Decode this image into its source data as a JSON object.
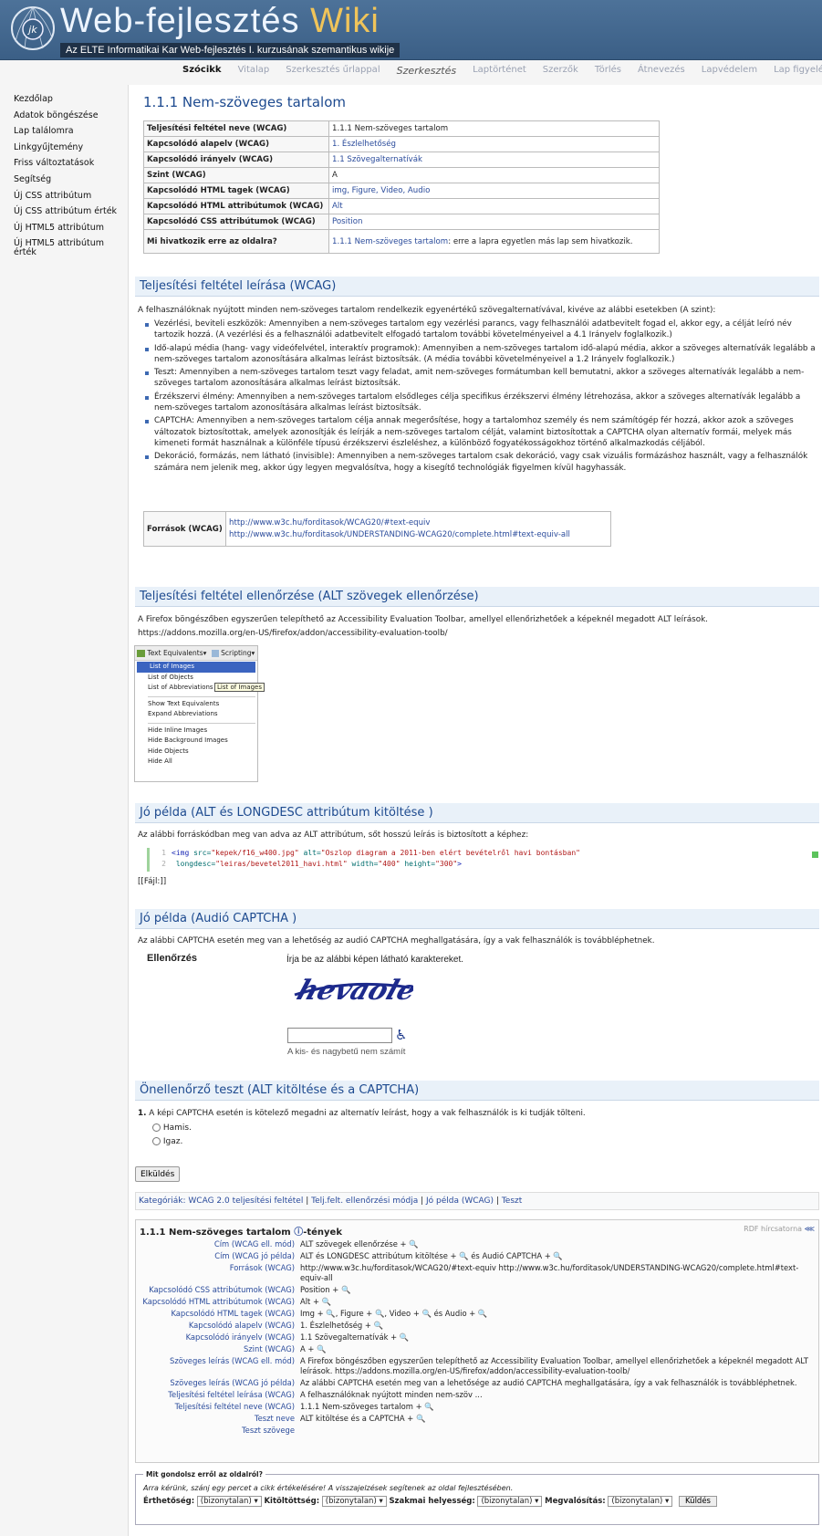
{
  "header": {
    "title_main": "Web-fejlesztés",
    "title_wiki": "Wiki",
    "subtitle": "Az ELTE Informatikai Kar Web-fejlesztés I. kurzusának szemantikus wikije",
    "logo_text": "jk"
  },
  "tabs": [
    "Szócikk",
    "Vitalap",
    "Szerkesztés űrlappal",
    "Szerkesztés",
    "Laptörténet",
    "Szerzők",
    "Törlés",
    "Átnevezés",
    "Lapvédelem",
    "Lap figyelése"
  ],
  "sidebar": [
    "Kezdőlap",
    "Adatok böngészése",
    "Lap találomra",
    "Linkgyűjtemény",
    "Friss változtatások",
    "Segítség",
    "Új CSS attribútum",
    "Új CSS attribútum érték",
    "Új HTML5 attribútum",
    "Új HTML5 attribútum érték"
  ],
  "page_title": "1.1.1 Nem-szöveges tartalom",
  "info_table": [
    {
      "k": "Teljesítési feltétel neve (WCAG)",
      "v": "1.1.1 Nem-szöveges tartalom",
      "link": false
    },
    {
      "k": "Kapcsolódó alapelv (WCAG)",
      "v": "1. Észlelhetőség",
      "link": true
    },
    {
      "k": "Kapcsolódó irányelv (WCAG)",
      "v": "1.1 Szövegalternatívák",
      "link": true
    },
    {
      "k": "Szint (WCAG)",
      "v": "A",
      "link": false
    },
    {
      "k": "Kapcsolódó HTML tagek (WCAG)",
      "v": "img, Figure, Video, Audio",
      "link": true
    },
    {
      "k": "Kapcsolódó HTML attribútumok (WCAG)",
      "v": "Alt",
      "link": true
    },
    {
      "k": "Kapcsolódó CSS attribútumok (WCAG)",
      "v": "Position",
      "link": true
    }
  ],
  "info_last": {
    "k": "Mi hivatkozik erre az oldalra?",
    "link": "1.1.1 Nem-szöveges tartalom",
    "rest": ": erre a lapra egyetlen más lap sem hivatkozik."
  },
  "sec1": {
    "title": "Teljesítési feltétel leírása (WCAG)",
    "intro": "A felhasználóknak nyújtott minden nem-szöveges tartalom rendelkezik egyenértékű szövegalternatívával, kivéve az alábbi esetekben (A szint):",
    "bullets": [
      "Vezérlési, beviteli eszközök: Amennyiben a nem-szöveges tartalom egy vezérlési parancs, vagy felhasználói adatbevitelt fogad el, akkor egy, a célját leíró név tartozik hozzá. (A vezérlési és a felhasználói adatbevitelt elfogadó tartalom további követelményeivel a 4.1 Irányelv foglalkozik.)",
      "Idő-alapú média (hang- vagy videófelvétel, interaktív programok): Amennyiben a nem-szöveges tartalom idő-alapú média, akkor a szöveges alternatívák legalább a nem-szöveges tartalom azonosítására alkalmas leírást biztosítsák. (A média további követelményeivel a 1.2 Irányelv foglalkozik.)",
      "Teszt: Amennyiben a nem-szöveges tartalom teszt vagy feladat, amit nem-szöveges formátumban kell bemutatni, akkor a szöveges alternatívák legalább a nem-szöveges tartalom azonosítására alkalmas leírást biztosítsák.",
      "Érzékszervi élmény: Amennyiben a nem-szöveges tartalom elsődleges célja specifikus érzékszervi élmény létrehozása, akkor a szöveges alternatívák legalább a nem-szöveges tartalom azonosítására alkalmas leírást biztosítsák.",
      "CAPTCHA: Amennyiben a nem-szöveges tartalom célja annak megerősítése, hogy a tartalomhoz személy és nem számítógép fér hozzá, akkor azok a szöveges változatok biztosítottak, amelyek azonosítják és leírják a nem-szöveges tartalom célját, valamint biztosítottak a CAPTCHA olyan alternatív formái, melyek más kimeneti formát használnak a különféle típusú érzékszervi észleléshez, a különböző fogyatékosságokhoz történő alkalmazkodás céljából.",
      "Dekoráció, formázás, nem látható (invisible): Amennyiben a nem-szöveges tartalom csak dekoráció, vagy csak vizuális formázáshoz használt, vagy a felhasználók számára nem jelenik meg, akkor úgy legyen megvalósítva, hogy a kisegítő technológiák figyelmen kívül hagyhassák."
    ],
    "sources_label": "Források (WCAG)",
    "sources": [
      "http://www.w3c.hu/forditasok/WCAG20/#text-equiv",
      "http://www.w3c.hu/forditasok/UNDERSTANDING-WCAG20/complete.html#text-equiv-all"
    ]
  },
  "sec2": {
    "title": "Teljesítési feltétel ellenőrzése (ALT szövegek ellenőrzése)",
    "text": "A Firefox böngészőben egyszerűen telepíthető az Accessibility Evaluation Toolbar, amellyel ellenőrizhetőek a képeknél megadott ALT leírások.",
    "url": "https://addons.mozilla.org/en-US/firefox/addon/accessibility-evaluation-toolb/",
    "toolbar": {
      "btn1": "Text Equivalents",
      "btn2": "Scripting"
    },
    "menu": [
      "List of Images",
      "List of Objects",
      "List of Abbreviations",
      "Show Text Equivalents",
      "Expand Abbreviations",
      "Hide Inline Images",
      "Hide Background Images",
      "Hide Objects",
      "Hide All"
    ],
    "tooltip": "List of Images"
  },
  "sec3": {
    "title": "Jó példa (ALT és LONGDESC attribútum kitöltése )",
    "text": "Az alábbi forráskódban meg van adva az ALT attribútum, sőt hosszú leírás is biztosított a képhez:",
    "file": "[[Fájl:]]",
    "code": {
      "l1_tag": "<img",
      "l1_a1": "src=",
      "l1_v1": "\"kepek/f16_w400.jpg\"",
      "l1_a2": "alt=",
      "l1_v2": "\"Oszlop diagram a 2011-ben elért bevételről havi bontásban\"",
      "l2_a1": "longdesc=",
      "l2_v1": "\"leiras/bevetel2011_havi.html\"",
      "l2_a2": "width=",
      "l2_v2": "\"400\"",
      "l2_a3": "height=",
      "l2_v3": "\"300\"",
      "l2_end": ">"
    }
  },
  "sec4": {
    "title": "Jó példa (Audió CAPTCHA )",
    "text": "Az alábbi CAPTCHA esetén meg van a lehetőség az audió CAPTCHA meghallgatására, így a vak felhasználók is továbbléphetnek.",
    "label": "Ellenőrzés",
    "instr": "Írja be az alábbi képen látható karaktereket.",
    "captcha_word": "hevaoler",
    "hint": "A kis- és nagybetű nem számít"
  },
  "sec5": {
    "title": "Önellenőrző teszt (ALT kitöltése és a CAPTCHA)",
    "q_num": "1.",
    "question": "A képi CAPTCHA esetén is kötelező megadni az alternatív leírást, hogy a vak felhasználók is ki tudják tölteni.",
    "options": [
      "Hamis.",
      "Igaz."
    ],
    "submit": "Elküldés"
  },
  "categories": {
    "label": "Kategóriák:",
    "items": [
      "WCAG 2.0 teljesítési feltétel",
      "Telj.felt. ellenőrzési módja",
      "Jó példa (WCAG)",
      "Teszt"
    ]
  },
  "facts": {
    "title": "1.1.1 Nem-szöveges tartalom",
    "suffix": "-tények",
    "rdf": "RDF hírcsatorna",
    "rows": [
      {
        "p": "Cím (WCAG ell. mód)",
        "v": "ALT szövegek ellenőrzése + 🔍"
      },
      {
        "p": "Cím (WCAG jó példa)",
        "v": "ALT és LONGDESC attribútum kitöltése + 🔍 és Audió CAPTCHA + 🔍"
      },
      {
        "p": "Források (WCAG)",
        "v": "http://www.w3c.hu/forditasok/WCAG20/#text-equiv     http://www.w3c.hu/forditasok/UNDERSTANDING-WCAG20/complete.html#text-equiv-all"
      },
      {
        "p": "Kapcsolódó CSS attribútumok (WCAG)",
        "v": "Position + 🔍"
      },
      {
        "p": "Kapcsolódó HTML attribútumok (WCAG)",
        "v": "Alt + 🔍"
      },
      {
        "p": "Kapcsolódó HTML tagek (WCAG)",
        "v": "Img + 🔍, Figure + 🔍, Video + 🔍 és Audio + 🔍"
      },
      {
        "p": "Kapcsolódó alapelv (WCAG)",
        "v": "1. Észlelhetőség + 🔍"
      },
      {
        "p": "Kapcsolódó irányelv (WCAG)",
        "v": "1.1 Szövegalternatívák + 🔍"
      },
      {
        "p": "Szint (WCAG)",
        "v": "A + 🔍"
      },
      {
        "p": "Szöveges leírás (WCAG ell. mód)",
        "v": "A Firefox böngészőben egyszerűen telepíthető az Accessibility Evaluation Toolbar, amellyel ellenőrizhetőek a képeknél megadott ALT leírások. https://addons.mozilla.org/en-US/firefox/addon/accessibility-evaluation-toolb/"
      },
      {
        "p": "Szöveges leírás (WCAG jó példa)",
        "v": "Az alábbi CAPTCHA esetén meg van a lehetősége az audió CAPTCHA meghallgatására, így a vak felhasználók is továbbléphetnek."
      },
      {
        "p": "Teljesítési feltétel leírása (WCAG)",
        "v": "A felhasználóknak nyújtott minden nem-szöv ..."
      },
      {
        "p": "Teljesítési feltétel neve (WCAG)",
        "v": "1.1.1 Nem-szöveges tartalom + 🔍"
      },
      {
        "p": "Teszt neve",
        "v": "ALT kitöltése és a CAPTCHA + 🔍"
      },
      {
        "p": "Teszt szövege",
        "v": ""
      }
    ]
  },
  "rating": {
    "legend": "Mit gondolsz erről az oldalról?",
    "prompt": "Arra kérünk, szánj egy percet a cikk értékelésére! A visszajelzések segítenek az oldal fejlesztésében.",
    "fields": [
      {
        "label": "Érthetőség:",
        "value": "(bizonytalan)"
      },
      {
        "label": "Kitöltöttség:",
        "value": "(bizonytalan)"
      },
      {
        "label": "Szakmai helyesség:",
        "value": "(bizonytalan)"
      },
      {
        "label": "Megvalósítás:",
        "value": "(bizonytalan)"
      }
    ],
    "submit": "Küldés"
  },
  "colors": {
    "header": "#446a91",
    "link": "#2a4b9b",
    "section_bg": "#e9f1f9"
  }
}
